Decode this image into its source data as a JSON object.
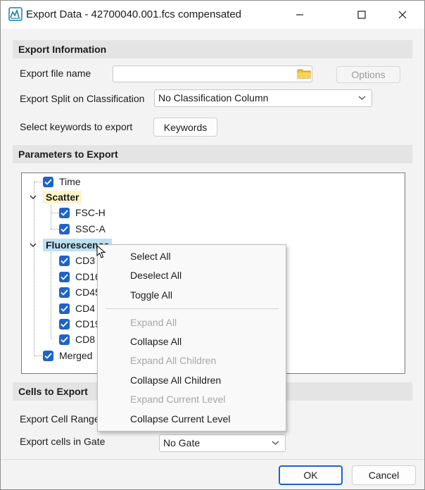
{
  "window": {
    "title": "Export Data - 42700040.001.fcs compensated",
    "minimize_icon": "minimize-icon",
    "maximize_icon": "maximize-icon",
    "close_icon": "close-icon"
  },
  "export_info": {
    "header": "Export Information",
    "file_name_label": "Export file name",
    "file_name_value": "",
    "options_label": "Options",
    "split_label": "Export Split on Classification",
    "split_value": "No Classification Column",
    "keywords_label": "Select keywords to export",
    "keywords_button": "Keywords"
  },
  "parameters": {
    "header": "Parameters to Export",
    "tree": {
      "time": "Time",
      "scatter_group": "Scatter",
      "scatter_items": [
        "FSC-H",
        "SSC-A"
      ],
      "fluorescence_group": "Fluorescence",
      "fluorescence_items": [
        "CD3",
        "CD16",
        "CD45",
        "CD4",
        "CD19",
        "CD8"
      ],
      "merged": "Merged"
    }
  },
  "context_menu": {
    "items": [
      {
        "label": "Select All",
        "enabled": true
      },
      {
        "label": "Deselect All",
        "enabled": true
      },
      {
        "label": "Toggle All",
        "enabled": true
      },
      {
        "label": "Expand All",
        "enabled": false
      },
      {
        "label": "Collapse All",
        "enabled": true
      },
      {
        "label": "Expand All Children",
        "enabled": false
      },
      {
        "label": "Collapse All Children",
        "enabled": true
      },
      {
        "label": "Expand Current Level",
        "enabled": false
      },
      {
        "label": "Collapse Current Level",
        "enabled": true
      }
    ]
  },
  "cells": {
    "header": "Cells to Export",
    "range_label": "Export Cell Range",
    "gate_label": "Export cells in Gate",
    "gate_value": "No Gate"
  },
  "footer": {
    "ok_label": "OK",
    "cancel_label": "Cancel"
  },
  "colors": {
    "checkbox": "#1e63c8",
    "scatter_highlight": "#fdf4c8",
    "fluorescence_highlight": "#bde0f4"
  }
}
